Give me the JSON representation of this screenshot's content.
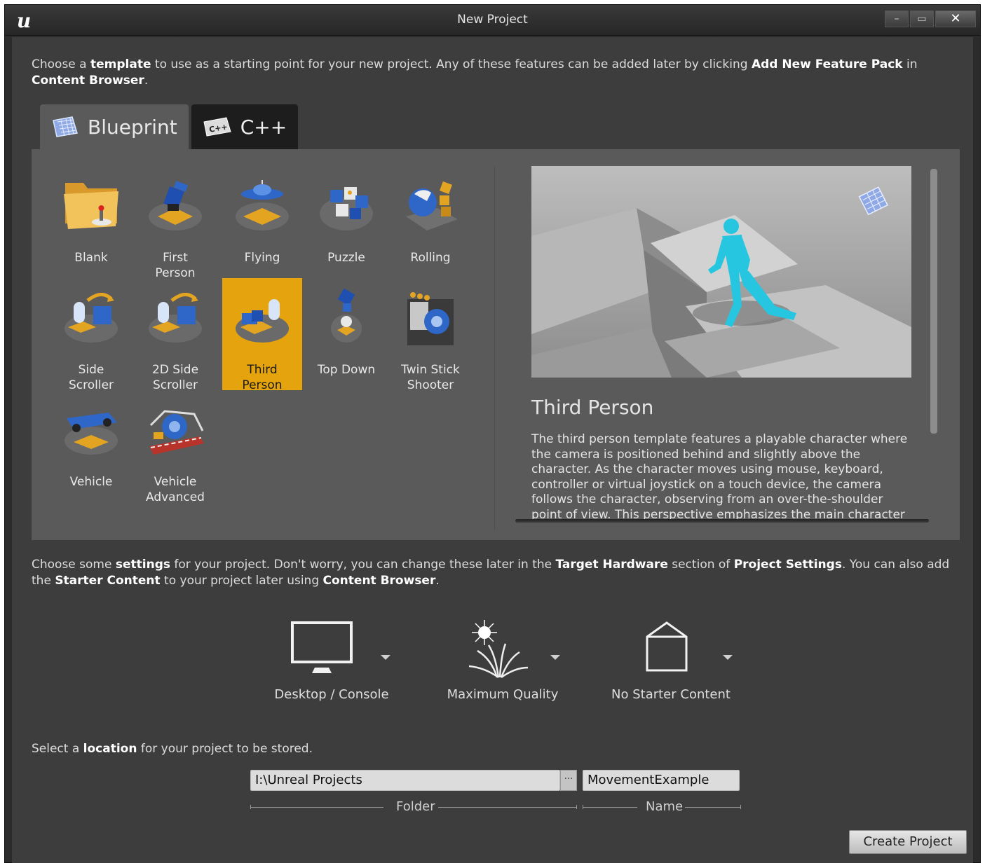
{
  "window": {
    "title": "New Project",
    "logo": "ue-logo",
    "controls": [
      "–",
      "▭",
      "✕"
    ]
  },
  "intro": {
    "p1": "Choose a ",
    "b1": "template",
    "p2": " to use as a starting point for your new project.  Any of these features can be added later by clicking ",
    "b2": "Add New Feature Pack",
    "p3": " in ",
    "b3": "Content Browser",
    "p4": "."
  },
  "tabs": [
    {
      "label": "Blueprint",
      "icon": "blueprint-icon"
    },
    {
      "label": "C++",
      "icon": "cpp-icon",
      "icon_text": "C++"
    }
  ],
  "templates": [
    {
      "label": "Blank",
      "icon": "folder-icon"
    },
    {
      "label": "First\nPerson",
      "icon": "first-person-icon"
    },
    {
      "label": "Flying",
      "icon": "flying-icon"
    },
    {
      "label": "Puzzle",
      "icon": "puzzle-icon"
    },
    {
      "label": "Rolling",
      "icon": "rolling-icon"
    },
    {
      "label": "Side\nScroller",
      "icon": "side-scroller-icon"
    },
    {
      "label": "2D Side\nScroller",
      "icon": "2d-side-scroller-icon"
    },
    {
      "label": "Third\nPerson",
      "icon": "third-person-icon",
      "selected": true
    },
    {
      "label": "Top Down",
      "icon": "top-down-icon"
    },
    {
      "label": "Twin Stick\nShooter",
      "icon": "twin-stick-shooter-icon"
    },
    {
      "label": "Vehicle",
      "icon": "vehicle-icon"
    },
    {
      "label": "Vehicle\nAdvanced",
      "icon": "vehicle-advanced-icon"
    }
  ],
  "detail": {
    "title": "Third Person",
    "description": "The third person template features a playable character where the camera is positioned behind and slightly above the character. As the character moves using mouse, keyboard, controller or virtual joystick on a touch device, the camera follows the character, observing from an over-the-shoulder point of view. This perspective emphasizes the main character and is popular in"
  },
  "settings_intro": {
    "p1": "Choose some ",
    "b1": "settings",
    "p2": " for your project.  Don't worry, you can change these later in the ",
    "b2": "Target Hardware",
    "p3": " section of ",
    "b3": "Project Settings",
    "p4": ".  You can also add the ",
    "b4": "Starter Content",
    "p5": " to your project later using ",
    "b5": "Content Browser",
    "p6": "."
  },
  "settings": [
    {
      "label": "Desktop / Console",
      "icon": "monitor-icon"
    },
    {
      "label": "Maximum Quality",
      "icon": "quality-icon"
    },
    {
      "label": "No Starter Content",
      "icon": "empty-box-icon"
    }
  ],
  "location": {
    "p1": "Select a ",
    "b1": "location",
    "p2": " for your project to be stored.",
    "folder_value": "I:\\Unreal Projects",
    "browse_label": "···",
    "folder_caption": "Folder",
    "name_value": "MovementExample",
    "name_caption": "Name"
  },
  "create_button": "Create Project",
  "colors": {
    "selected": "#e5a30e",
    "accent_blue": "#2e67c8",
    "character_cyan": "#27c6e0"
  }
}
